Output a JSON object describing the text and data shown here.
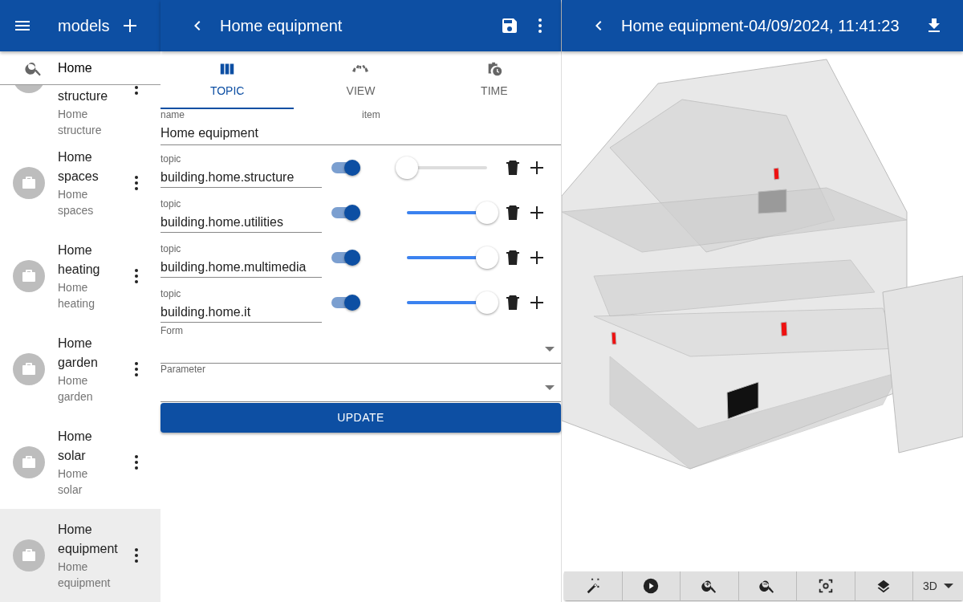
{
  "sidebar": {
    "title": "models",
    "search": {
      "value": "Home"
    },
    "items": [
      {
        "name": "structure",
        "subtitle": "Home structure",
        "selected": false,
        "partial": true
      },
      {
        "name": "Home spaces",
        "subtitle": "Home spaces",
        "selected": false
      },
      {
        "name": "Home heating",
        "subtitle": "Home heating",
        "selected": false
      },
      {
        "name": "Home garden",
        "subtitle": "Home garden",
        "selected": false
      },
      {
        "name": "Home solar",
        "subtitle": "Home solar",
        "selected": false
      },
      {
        "name": "Home equipment",
        "subtitle": "Home equipment",
        "selected": true
      }
    ]
  },
  "editor": {
    "title": "Home equipment",
    "tabs": [
      {
        "label": "TOPIC",
        "selected": true
      },
      {
        "label": "VIEW",
        "selected": false
      },
      {
        "label": "TIME",
        "selected": false
      }
    ],
    "name_field": {
      "label": "name",
      "hint": "item",
      "value": "Home equipment"
    },
    "topics": [
      {
        "label": "topic",
        "value": "building.home.structure",
        "on": true,
        "level": 0
      },
      {
        "label": "topic",
        "value": "building.home.utilities",
        "on": true,
        "level": 1
      },
      {
        "label": "topic",
        "value": "building.home.multimedia",
        "on": true,
        "level": 1
      },
      {
        "label": "topic",
        "value": "building.home.it",
        "on": true,
        "level": 1
      }
    ],
    "selects": [
      {
        "label": "Form"
      },
      {
        "label": "Parameter"
      }
    ],
    "update_button": "UPDATE"
  },
  "viewer": {
    "title": "Home equipment-04/09/2024, 11:41:23",
    "toolbar": [
      {
        "kind": "wand"
      },
      {
        "kind": "play"
      },
      {
        "kind": "zoom-in"
      },
      {
        "kind": "zoom-out"
      },
      {
        "kind": "focus"
      },
      {
        "kind": "layers"
      },
      {
        "kind": "mode",
        "label": "3D"
      }
    ]
  }
}
